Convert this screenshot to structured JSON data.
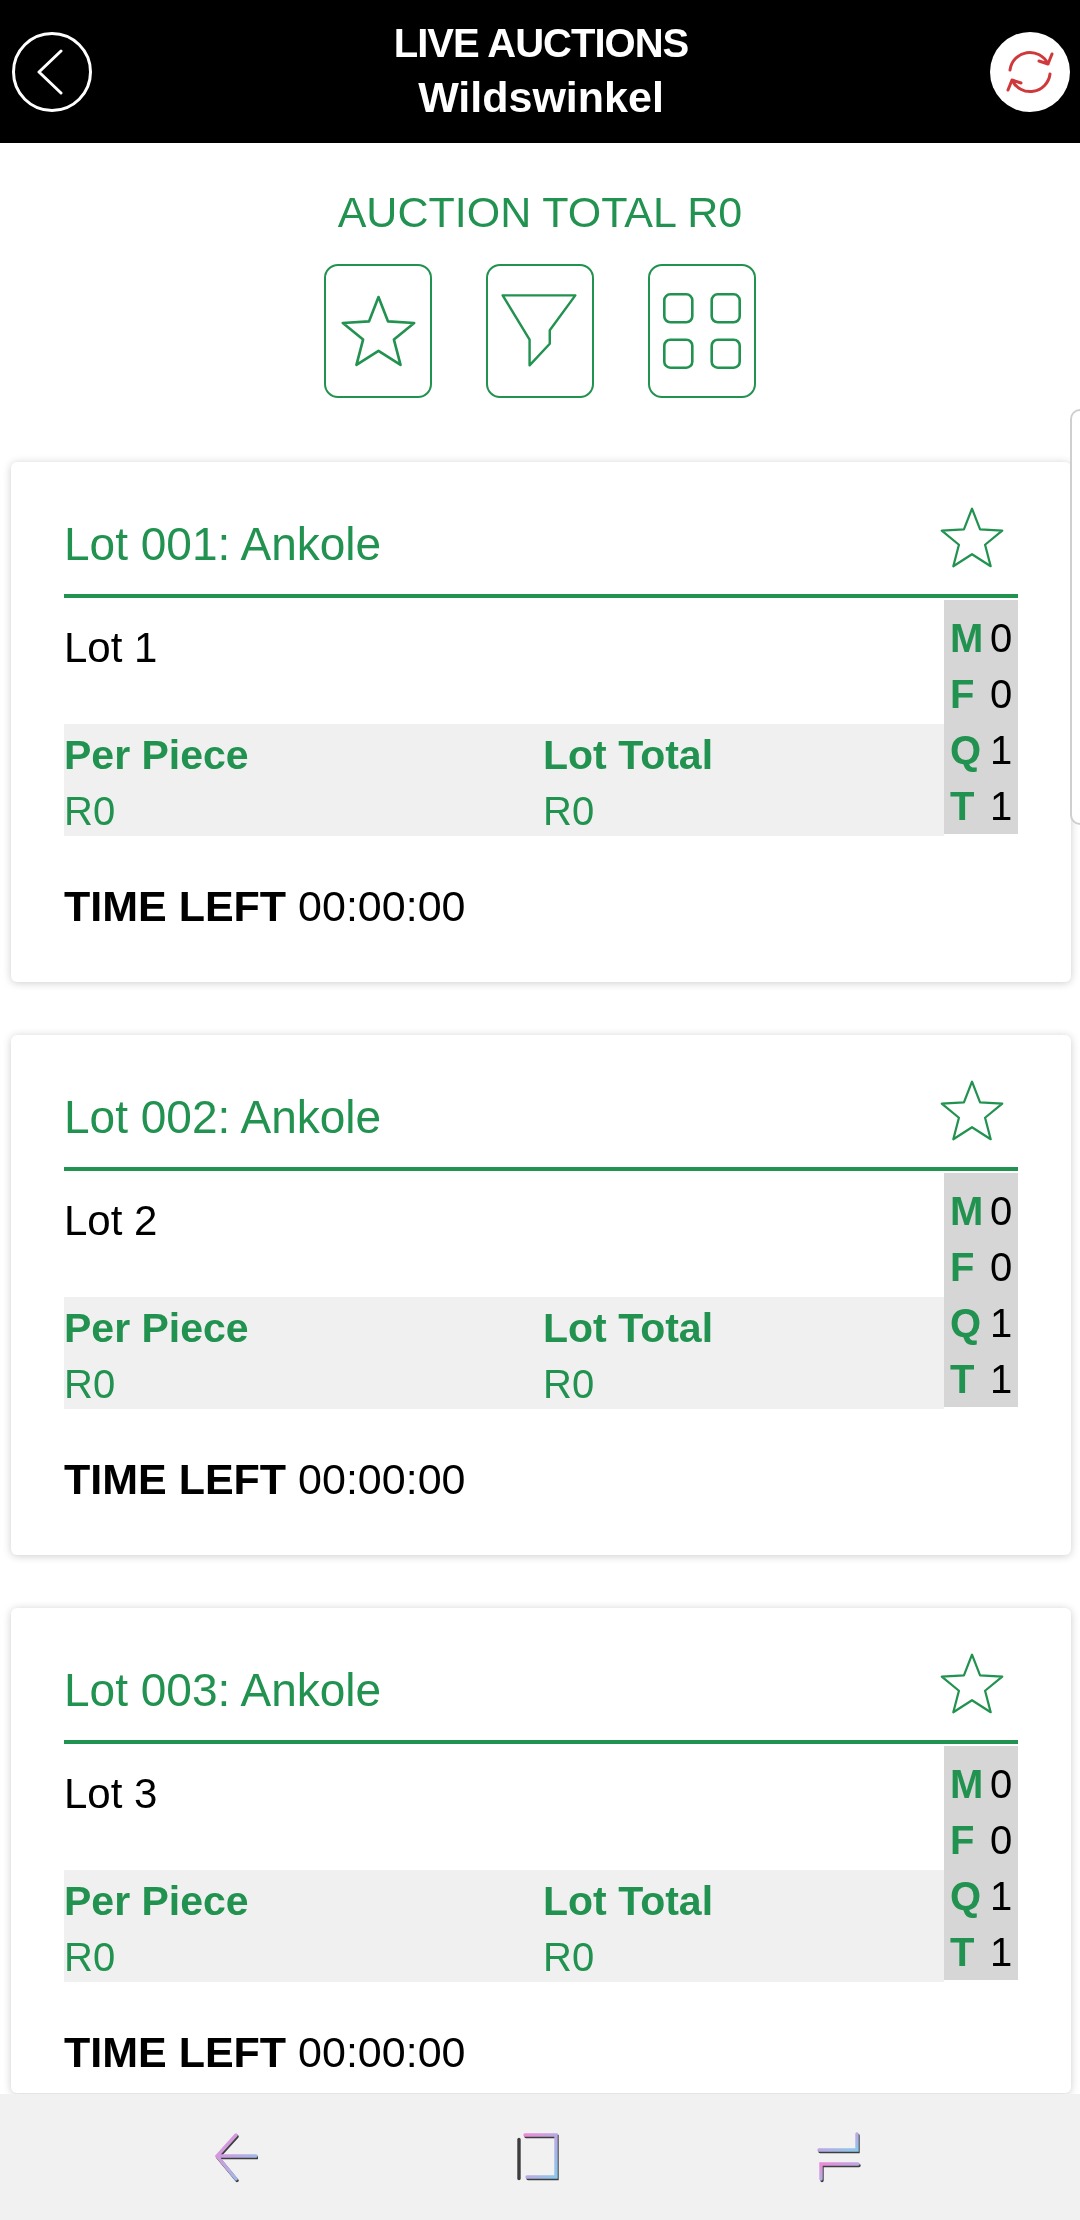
{
  "header": {
    "title": "LIVE AUCTIONS",
    "subtitle": "Wildswinkel"
  },
  "auction_total": "AUCTION TOTAL R0",
  "lots": [
    {
      "title": "Lot 001: Ankole",
      "favorite": false,
      "description": "Lot 1",
      "prices": [
        {
          "label": "Per Piece",
          "value": "R0"
        },
        {
          "label": "Lot Total",
          "value": "R0"
        }
      ],
      "counts": [
        {
          "label": "M",
          "value": "0"
        },
        {
          "label": "F",
          "value": "0"
        },
        {
          "label": "Q",
          "value": "1"
        },
        {
          "label": "T",
          "value": "1"
        }
      ],
      "time_left_label": "TIME LEFT",
      "time_left": "00:00:00"
    },
    {
      "title": "Lot 002: Ankole",
      "favorite": false,
      "description": "Lot 2",
      "prices": [
        {
          "label": "Per Piece",
          "value": "R0"
        },
        {
          "label": "Lot Total",
          "value": "R0"
        }
      ],
      "counts": [
        {
          "label": "M",
          "value": "0"
        },
        {
          "label": "F",
          "value": "0"
        },
        {
          "label": "Q",
          "value": "1"
        },
        {
          "label": "T",
          "value": "1"
        }
      ],
      "time_left_label": "TIME LEFT",
      "time_left": "00:00:00"
    },
    {
      "title": "Lot 003: Ankole",
      "favorite": false,
      "description": "Lot 3",
      "prices": [
        {
          "label": "Per Piece",
          "value": "R0"
        },
        {
          "label": "Lot Total",
          "value": "R0"
        }
      ],
      "counts": [
        {
          "label": "M",
          "value": "0"
        },
        {
          "label": "F",
          "value": "0"
        },
        {
          "label": "Q",
          "value": "1"
        },
        {
          "label": "T",
          "value": "1"
        }
      ],
      "time_left_label": "TIME LEFT",
      "time_left": "00:00:00"
    }
  ]
}
